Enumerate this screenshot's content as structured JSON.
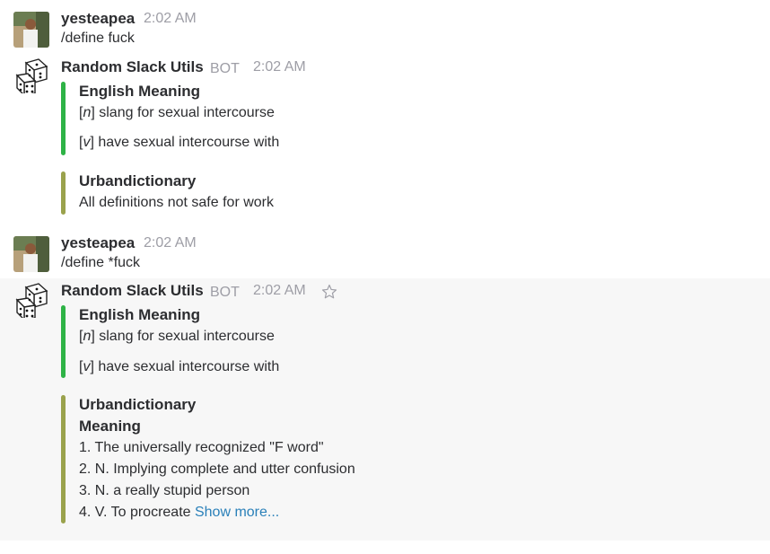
{
  "messages": [
    {
      "user": "yesteapea",
      "time": "2:02 AM",
      "text": "/define fuck"
    },
    {
      "user": "Random Slack Utils",
      "badge": "BOT",
      "time": "2:02 AM",
      "english": {
        "title": "English Meaning",
        "noun_tag": "n",
        "noun_def": "slang for sexual intercourse",
        "verb_tag": "v",
        "verb_def": "have sexual intercourse with",
        "color": "#2eb346"
      },
      "urban": {
        "title": "Urbandictionary",
        "line": "All definitions not safe for work",
        "color": "#9aa24c"
      }
    },
    {
      "user": "yesteapea",
      "time": "2:02 AM",
      "text": "/define *fuck"
    },
    {
      "user": "Random Slack Utils",
      "badge": "BOT",
      "time": "2:02 AM",
      "english": {
        "title": "English Meaning",
        "noun_tag": "n",
        "noun_def": "slang for sexual intercourse",
        "verb_tag": "v",
        "verb_def": "have sexual intercourse with",
        "color": "#2eb346"
      },
      "urban": {
        "title": "Urbandictionary",
        "subtitle": "Meaning",
        "items": [
          "1. The universally recognized \"F word\"",
          "2. N. Implying complete and utter confusion",
          "3. N. a really stupid person",
          "4. V. To procreate"
        ],
        "show_more": "Show more...",
        "color": "#9aa24c"
      }
    }
  ],
  "icons": {
    "star": "star-icon",
    "avatar_user": "user-photo",
    "avatar_bot": "dice-icon"
  }
}
